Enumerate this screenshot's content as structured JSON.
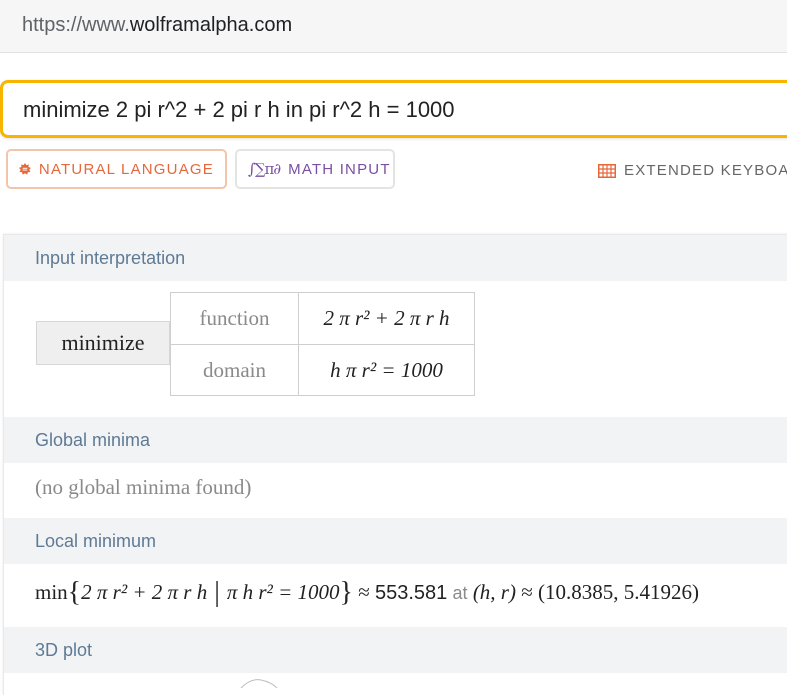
{
  "browser": {
    "url_prefix": "https://www.",
    "url_domain": "wolframalpha.com"
  },
  "query": {
    "value": "minimize 2 pi r^2 + 2 pi r h in pi r^2 h = 1000"
  },
  "modes": {
    "natural_language": "NATURAL LANGUAGE",
    "natural_language_icon": "natural-language-icon",
    "math_input": "MATH INPUT",
    "math_input_icon_text": "∫∑π∂",
    "extended_keyboard": "EXTENDED KEYBOAR",
    "keyboard_icon": "keyboard-icon"
  },
  "accent": {
    "query_border": "#f7b500",
    "natural_language": "#e5673a",
    "math_input": "#7a4ea3"
  },
  "pods": {
    "input_interpretation": {
      "title": "Input interpretation",
      "operation": "minimize",
      "rows": [
        {
          "label": "function",
          "value": "2 π r² + 2 π r h"
        },
        {
          "label": "domain",
          "value": "h π r² = 1000"
        }
      ]
    },
    "global_minima": {
      "title": "Global minima",
      "text": "(no global minima found)"
    },
    "local_minimum": {
      "title": "Local minimum",
      "min_label": "min",
      "expression": "2 π r² + 2 π r h",
      "constraint": "π h r² = 1000",
      "approx": "≈",
      "value": "553.581",
      "at_label": "at",
      "vars": "(h, r)",
      "point": "(10.8385, 5.41926)"
    },
    "plot": {
      "title": "3D plot"
    }
  }
}
